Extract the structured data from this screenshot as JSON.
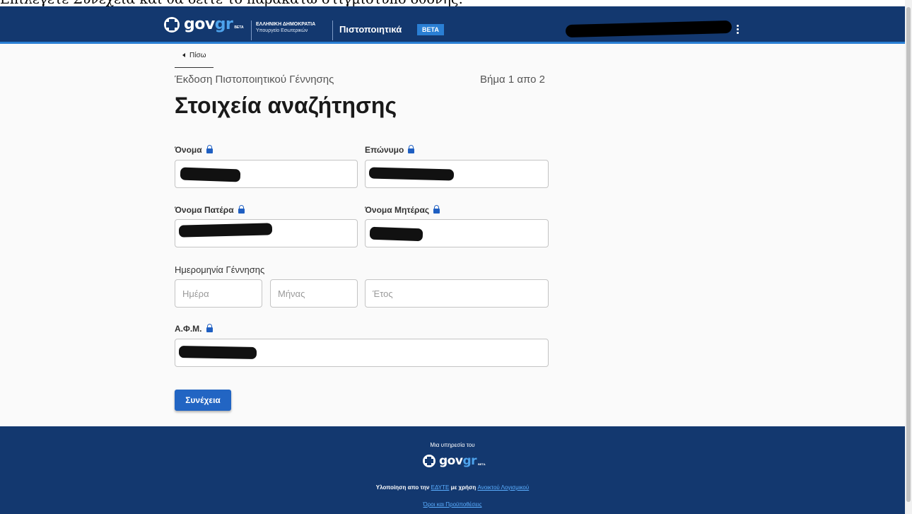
{
  "caption": "Επιλέγετε Συνέχεια και θα δείτε το παρακάτω στιγμιότυπο οθόνης:",
  "header": {
    "logo_main": "gov",
    "logo_accent": "gr",
    "logo_beta": "BETA",
    "ministry_line1": "ΕΛΛΗΝΙΚΗ ΔΗΜΟΚΡΑΤΙΑ",
    "ministry_line2": "Υπουργείο Εσωτερικών",
    "app_title": "Πιστοποιητικά",
    "beta_badge": "BETA"
  },
  "nav": {
    "back_label": "Πίσω"
  },
  "form": {
    "subtitle": "Έκδοση Πιστοποιητικού Γέννησης",
    "step": "Βήμα 1 απο 2",
    "title": "Στοιχεία αναζήτησης",
    "first_name_label": "Όνομα",
    "last_name_label": "Επώνυμο",
    "father_name_label": "Όνομα Πατέρα",
    "mother_name_label": "Όνομα Μητέρας",
    "birth_date_label": "Ημερομηνία Γέννησης",
    "day_placeholder": "Ημέρα",
    "month_placeholder": "Μήνας",
    "year_placeholder": "Έτος",
    "afm_label": "Α.Φ.Μ.",
    "continue_button": "Συνέχεια"
  },
  "footer": {
    "service_of": "Μια υπηρεσία του",
    "logo_main": "gov",
    "logo_accent": "gr",
    "logo_beta": "BETA",
    "impl_prefix": "Υλοποίηση απο την",
    "impl_org": "ΕΔΥΤΕ",
    "impl_middle": "με χρήση",
    "impl_software": "Ανοικτού Λογισμικού",
    "terms": "Όροι και Προϋποθέσεις"
  },
  "colors": {
    "header_bg": "#13386f",
    "accent": "#2a7fd4",
    "button": "#2265c3",
    "lock": "#1f5fc2"
  }
}
